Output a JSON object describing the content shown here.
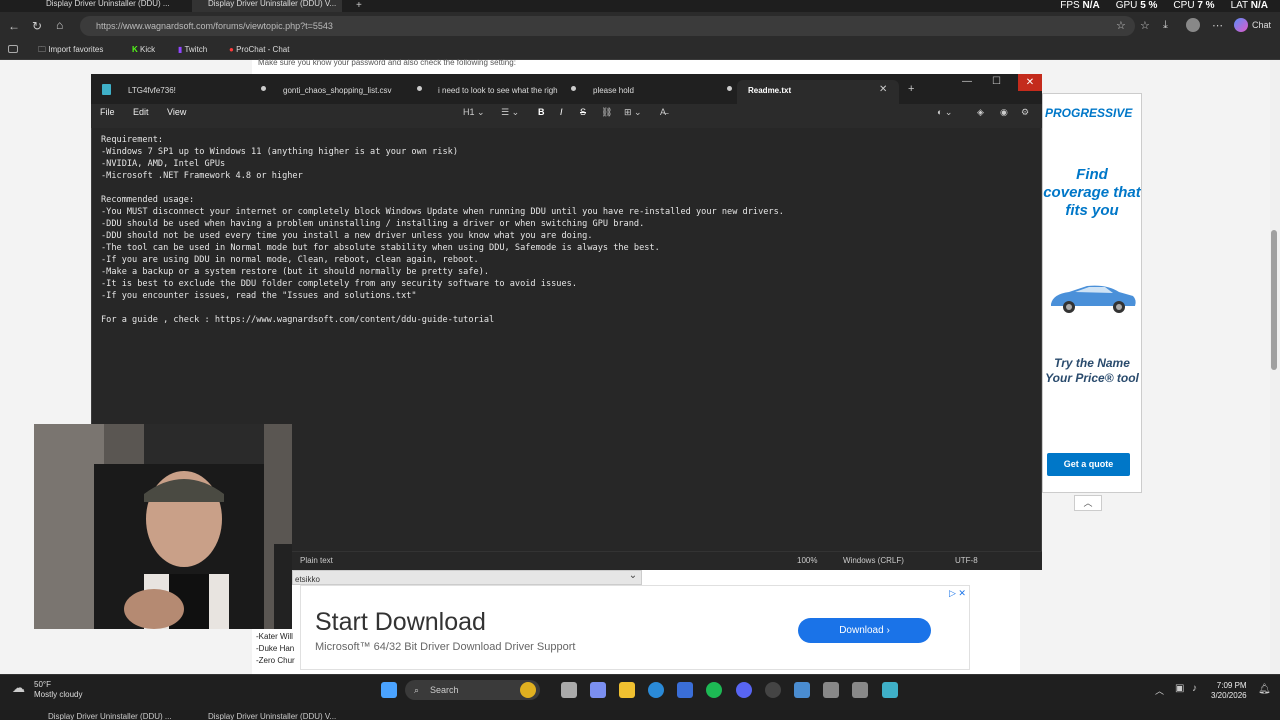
{
  "browser": {
    "tabs": [
      {
        "label": "Display Driver Uninstaller (DDU) ..."
      },
      {
        "label": "Display Driver Uninstaller (DDU) V..."
      }
    ],
    "overlay": {
      "fps_label": "FPS",
      "fps_value": "N/A",
      "gpu_label": "GPU",
      "gpu_value": "5 %",
      "cpu_label": "CPU",
      "cpu_value": "7 %",
      "lat_label": "LAT",
      "lat_value": "N/A"
    },
    "url": "https://www.wagnardsoft.com/forums/viewtopic.php?t=5543",
    "chat_label": "Chat",
    "favorites": [
      {
        "label": "Import favorites",
        "icon": "import-icon"
      },
      {
        "label": "Kick",
        "icon": "kick-icon",
        "color": "#53fc18"
      },
      {
        "label": "Twitch",
        "icon": "twitch-icon",
        "color": "#9146ff"
      },
      {
        "label": "ProChat - Chat",
        "icon": "prochat-icon",
        "color": "#ff3b3b"
      }
    ]
  },
  "page": {
    "top_text": "Make sure you know your password and also check the following setting:"
  },
  "notepad": {
    "tabs": [
      {
        "label": "LTG4fvfe736!"
      },
      {
        "label": "gonti_chaos_shopping_list.csv"
      },
      {
        "label": "i need to look to see what the righ"
      },
      {
        "label": "please hold"
      },
      {
        "label": "Readme.txt"
      }
    ],
    "menus": {
      "file": "File",
      "edit": "Edit",
      "view": "View"
    },
    "heading_select": "H1",
    "lines": [
      "Requirement:",
      "-Windows 7 SP1 up to Windows 11 (anything higher is at your own risk)",
      "-NVIDIA, AMD, Intel GPUs",
      "-Microsoft .NET Framework 4.8 or higher",
      "",
      "Recommended usage:",
      "-You MUST disconnect your internet or completely block Windows Update when running DDU until you have re-installed your new drivers.",
      "-DDU should be used when having a problem uninstalling / installing a driver or when switching GPU brand.",
      "-DDU should not be used every time you install a new driver unless you know what you are doing.",
      "-The tool can be used in Normal mode but for absolute stability when using DDU, Safemode is always the best.",
      "-If you are using DDU in normal mode, Clean, reboot, clean again, reboot.",
      "-Make a backup or a system restore (but it should normally be pretty safe).",
      "-It is best to exclude the DDU folder completely from any security software to avoid issues.",
      "-If you encounter issues, read the \"Issues and solutions.txt\"",
      "",
      "For a guide , check : https://www.wagnardsoft.com/content/ddu-guide-tutorial"
    ],
    "status": {
      "format": "Plain text",
      "zoom": "100%",
      "line_ending": "Windows (CRLF)",
      "encoding": "UTF-8"
    }
  },
  "ad_right": {
    "brand": "PROGRESSIVE",
    "headline": "Find coverage that fits you",
    "subtext": "Try the Name Your Price® tool",
    "button": "Get a quote"
  },
  "lower": {
    "header_label": "etsikko",
    "left_names": [
      "-Kater Will",
      "-Duke Han",
      "-Zero Chur"
    ],
    "ad_title": "Start Download",
    "ad_subtitle": "Microsoft™ 64/32 Bit Driver Download Driver Support",
    "ad_button": "Download"
  },
  "taskbar": {
    "temp": "50°F",
    "weather": "Mostly cloudy",
    "search": "Search",
    "time": "7:09 PM",
    "date": "3/20/2026"
  }
}
